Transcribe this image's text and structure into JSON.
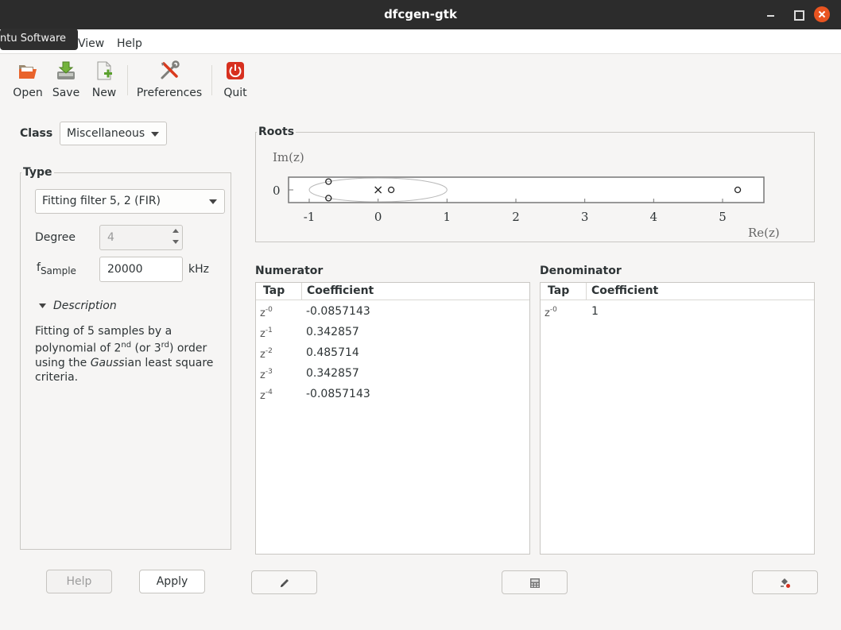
{
  "window": {
    "title": "dfcgen-gtk"
  },
  "tooltip": {
    "text": "ntu Software"
  },
  "menubar": {
    "items": [
      "View",
      "Help"
    ]
  },
  "toolbar": {
    "open_label": "Open",
    "save_label": "Save",
    "new_label": "New",
    "preferences_label": "Preferences",
    "quit_label": "Quit"
  },
  "class_selector": {
    "label": "Class",
    "value": "Miscellaneous"
  },
  "type_frame": {
    "title": "Type",
    "filter_value": "Fitting filter 5, 2 (FIR)",
    "degree_label": "Degree",
    "degree_value": "4",
    "fsample_label_main": "f",
    "fsample_label_sub": "Sample",
    "fsample_value": "20000",
    "fsample_unit": "kHz",
    "description_label": "Description",
    "description": {
      "part1": "Fitting of 5 samples by a polynomial of 2",
      "sup1": "nd",
      "part2": " (or 3",
      "sup2": "rd",
      "part3": ") order using the ",
      "italic": "Gauss",
      "part4": "ian least square criteria."
    }
  },
  "roots": {
    "title": "Roots",
    "ylabel": "Im(z)",
    "xlabel": "Re(z)",
    "y_tick": "0",
    "x_ticks": [
      "-1",
      "0",
      "1",
      "2",
      "3",
      "4",
      "5"
    ]
  },
  "chart_data": {
    "type": "scatter",
    "title": "",
    "xlabel": "Re(z)",
    "ylabel": "Im(z)",
    "xlim": [
      -1.3,
      5.6
    ],
    "ylim": [
      -0.2,
      0.2
    ],
    "unit_circle": true,
    "series": [
      {
        "name": "",
        "marker": "o",
        "points": [
          [
            -0.72,
            0.13
          ],
          [
            -0.72,
            -0.13
          ],
          [
            0.19,
            0.0
          ],
          [
            5.22,
            0.0
          ]
        ]
      },
      {
        "name": "",
        "marker": "x",
        "points": [
          [
            0.0,
            0.0
          ]
        ]
      }
    ]
  },
  "numerator": {
    "title": "Numerator",
    "col_tap": "Tap",
    "col_coef": "Coefficient",
    "rows": [
      {
        "base": "z",
        "exp": "-0",
        "coef": "-0.0857143"
      },
      {
        "base": "z",
        "exp": "-1",
        "coef": "0.342857"
      },
      {
        "base": "z",
        "exp": "-2",
        "coef": "0.485714"
      },
      {
        "base": "z",
        "exp": "-3",
        "coef": "0.342857"
      },
      {
        "base": "z",
        "exp": "-4",
        "coef": "-0.0857143"
      }
    ]
  },
  "denominator": {
    "title": "Denominator",
    "col_tap": "Tap",
    "col_coef": "Coefficient",
    "rows": [
      {
        "base": "z",
        "exp": "-0",
        "coef": "1"
      }
    ]
  },
  "buttons": {
    "help_label": "Help",
    "apply_label": "Apply"
  },
  "icons": {
    "open": "folder-open-icon",
    "save": "save-icon",
    "new": "new-document-icon",
    "preferences": "preferences-icon",
    "quit": "quit-icon",
    "edit": "pencil-icon",
    "calculator": "calculator-icon",
    "roots": "roots-edit-icon"
  },
  "colors": {
    "titlebar": "#2c2c2c",
    "close_button": "#e95420",
    "window_bg": "#f6f5f4"
  }
}
